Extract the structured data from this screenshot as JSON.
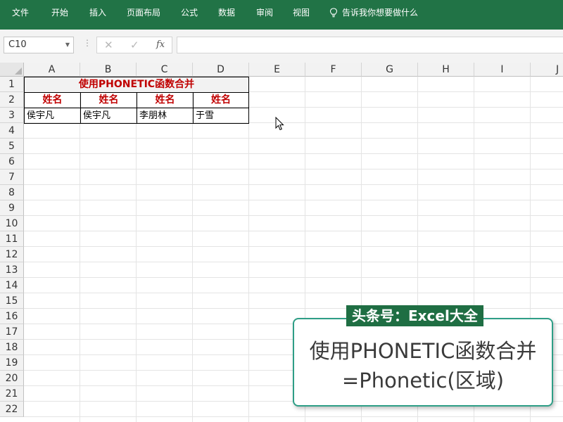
{
  "ribbon": {
    "tabs": [
      "文件",
      "开始",
      "插入",
      "页面布局",
      "公式",
      "数据",
      "审阅",
      "视图"
    ],
    "tell_me": "告诉我你想要做什么"
  },
  "formula_bar": {
    "name_box": "C10",
    "fx_label": "fx",
    "formula_value": ""
  },
  "sheet": {
    "columns": [
      "A",
      "B",
      "C",
      "D",
      "E",
      "F",
      "G",
      "H",
      "I",
      "J"
    ],
    "rows": [
      "1",
      "2",
      "3",
      "4",
      "5",
      "6",
      "7",
      "8",
      "9",
      "10",
      "11",
      "12",
      "13",
      "14",
      "15",
      "16",
      "17",
      "18",
      "19",
      "20",
      "21",
      "22"
    ],
    "title": "使用PHONETIC函数合并",
    "headers": [
      "姓名",
      "姓名",
      "姓名",
      "姓名"
    ],
    "names": [
      "侯宇凡",
      "侯宇凡",
      "李朋林",
      "于雪"
    ]
  },
  "overlay": {
    "badge": "头条号：Excel大全",
    "line1": "使用PHONETIC函数合并",
    "line2": "=Phonetic(区域)"
  },
  "colors": {
    "ribbon": "#217346",
    "accent_red": "#c00000",
    "card_border": "#2e9e86"
  }
}
